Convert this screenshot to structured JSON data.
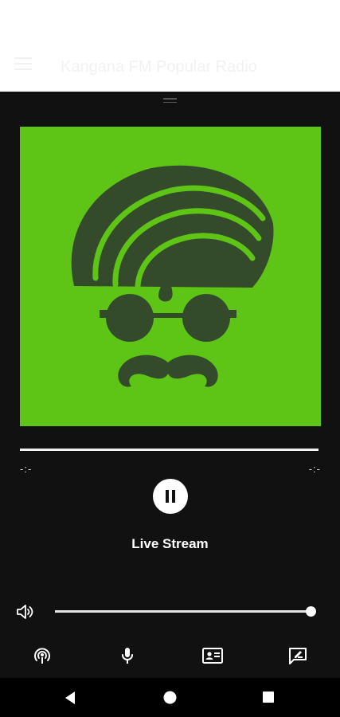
{
  "app_bar": {
    "title": "Kangana FM Popular Radio",
    "menu_icon": "hamburger-menu-icon"
  },
  "player": {
    "artwork": {
      "background_color": "#5ec516",
      "foreground_color": "#334b2b",
      "icon": "turban-man-logo"
    },
    "progress": {
      "elapsed": "-:-",
      "duration": "-:-",
      "fraction": 0
    },
    "state": "playing",
    "track_title": "Live Stream",
    "volume": {
      "level": 1.0,
      "icon": "speaker-volume-icon"
    }
  },
  "bottom_actions": [
    {
      "name": "podcast-icon"
    },
    {
      "name": "microphone-icon"
    },
    {
      "name": "contact-card-icon"
    },
    {
      "name": "feedback-icon"
    }
  ],
  "system_nav": {
    "back": "back-triangle-icon",
    "home": "home-circle-icon",
    "recents": "recents-square-icon"
  },
  "colors": {
    "sheet_background": "#111111",
    "accent_green": "#5ec516",
    "text_primary": "#ffffff"
  }
}
